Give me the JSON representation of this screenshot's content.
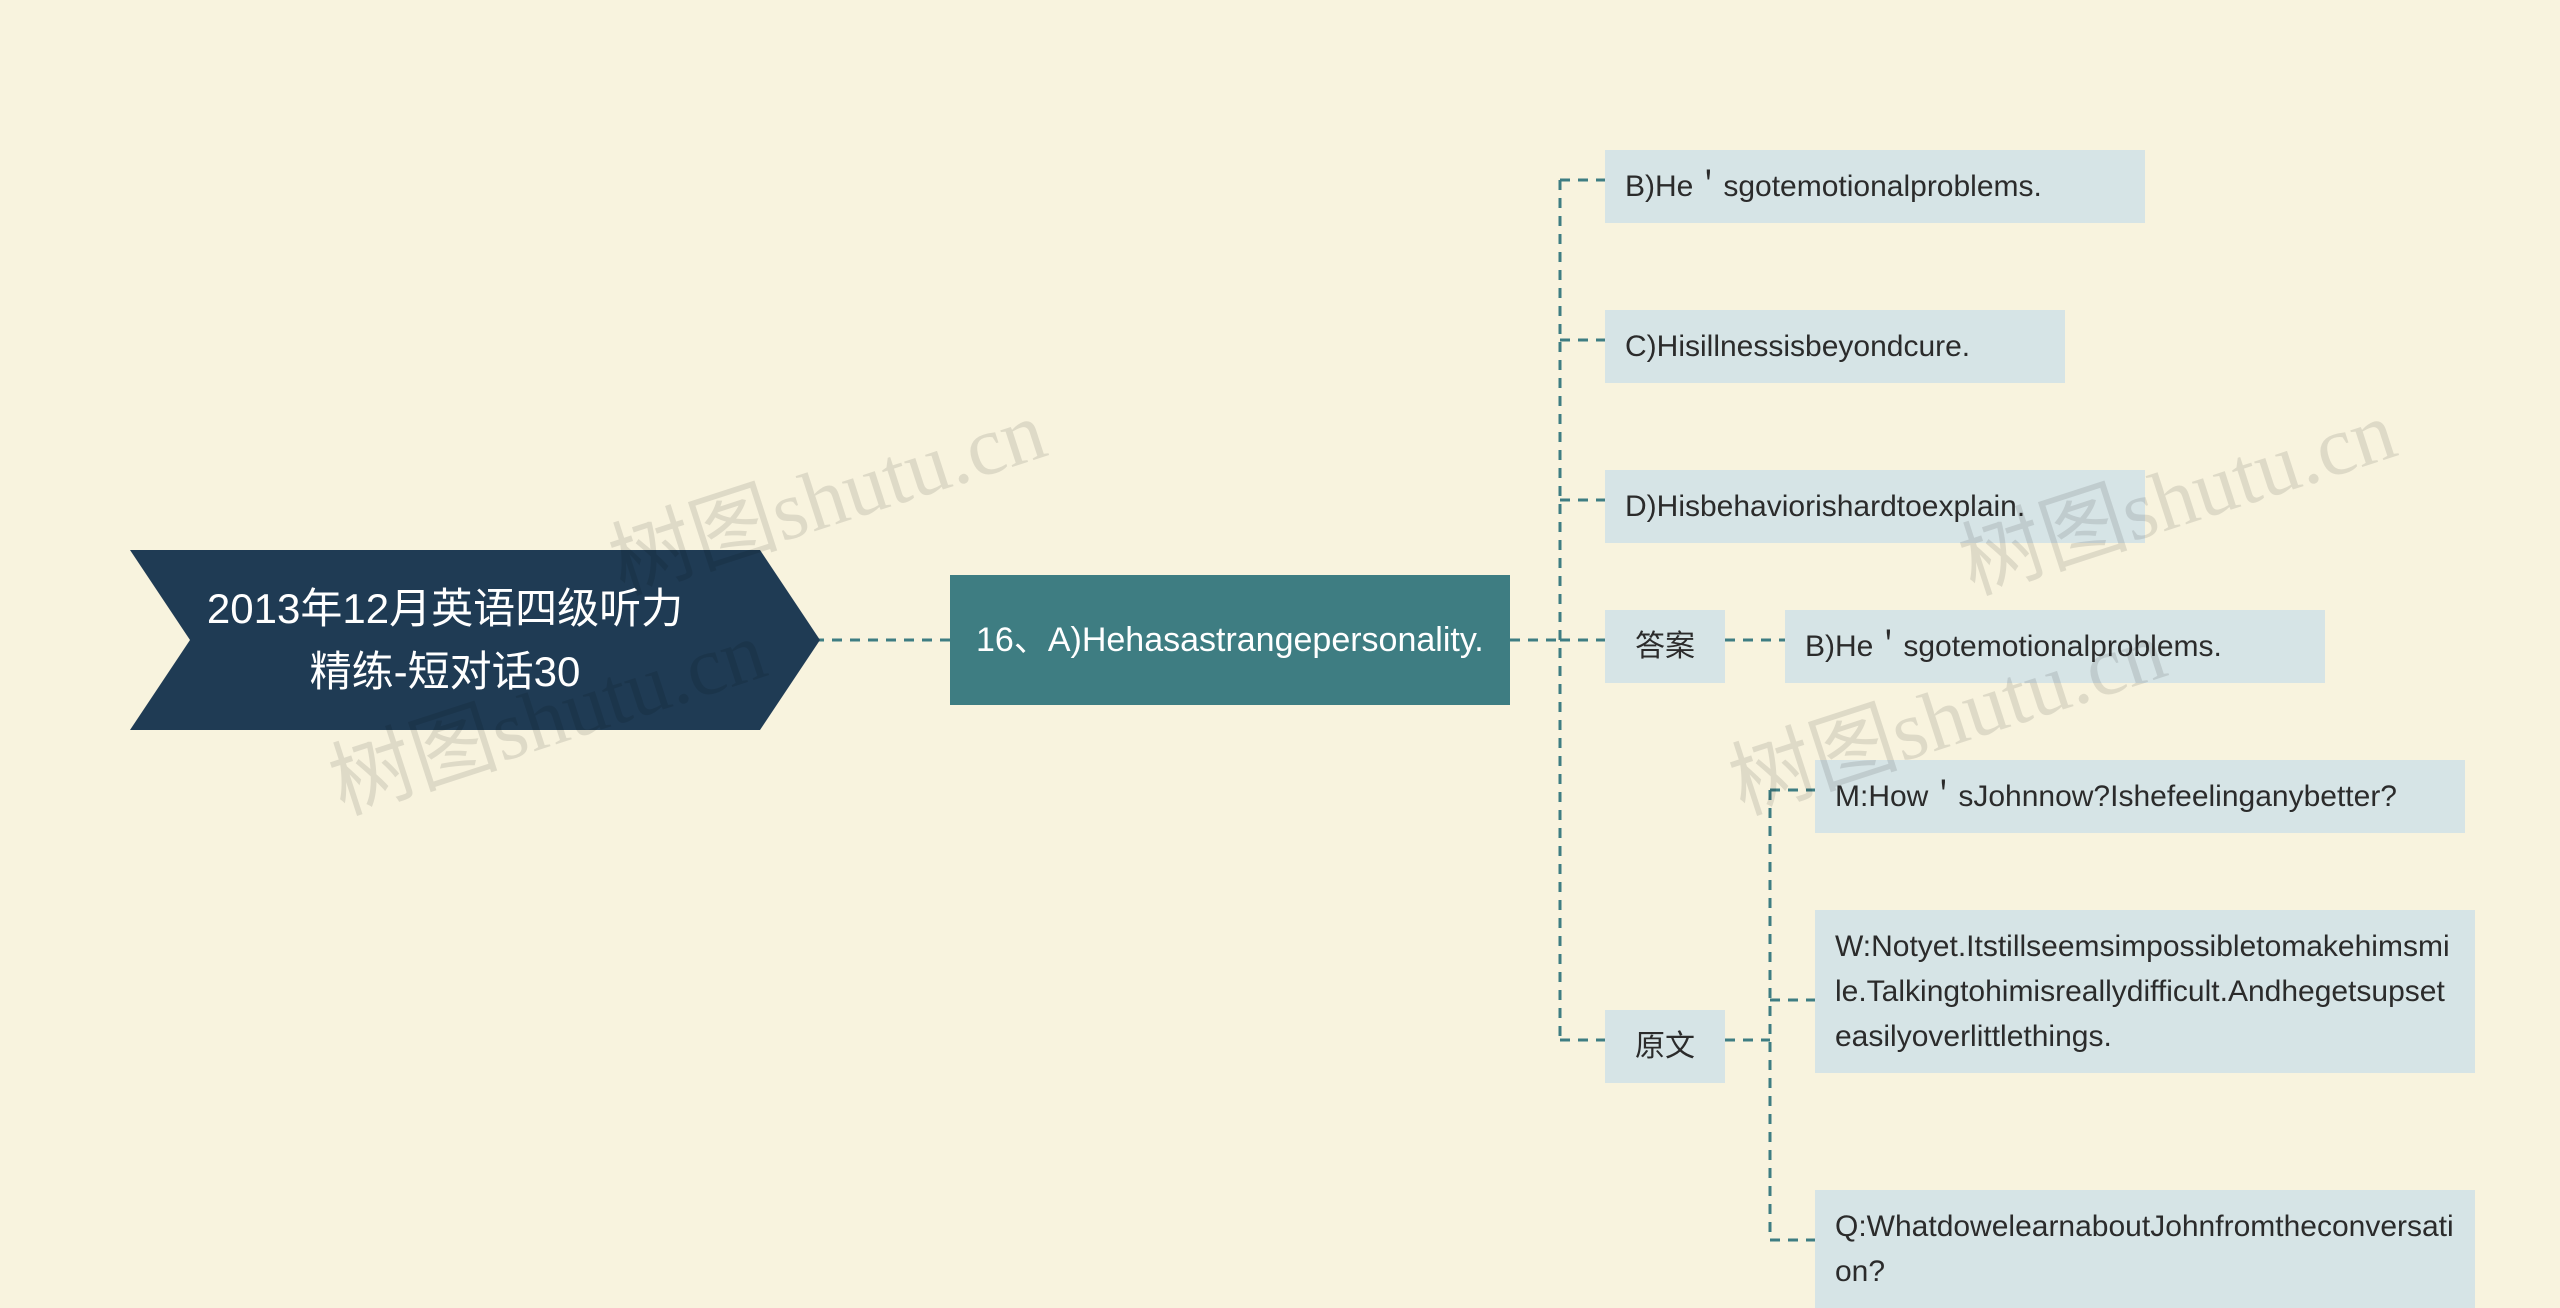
{
  "root": {
    "title_line1": "2013年12月英语四级听力",
    "title_line2": "精练-短对话30"
  },
  "level2": {
    "question_text": "16、A)Hehasastrangepersonality."
  },
  "options": {
    "b": "B)He＇sgotemotionalproblems.",
    "c": "C)Hisillnessisbeyondcure.",
    "d": "D)Hisbehaviorishardtoexplain."
  },
  "answer": {
    "label": "答案",
    "text": "B)He＇sgotemotionalproblems."
  },
  "source": {
    "label": "原文",
    "m": "M:How＇sJohnnow?Ishefeelinganybetter?",
    "w": "W:Notyet.Itstillseemsimpossibletomakehimsmile.Talkingtohimisreallydifficult.Andhegetsupseteasilyoverlittlethings.",
    "q": "Q:WhatdowelearnaboutJohnfromtheconversation?"
  },
  "watermark": "树图shutu.cn",
  "chart_data": {
    "type": "mindmap",
    "root": "2013年12月英语四级听力精练-短对话30",
    "children": [
      {
        "text": "16、A)Hehasastrangepersonality.",
        "children": [
          {
            "text": "B)He＇sgotemotionalproblems."
          },
          {
            "text": "C)Hisillnessisbeyondcure."
          },
          {
            "text": "D)Hisbehaviorishardtoexplain."
          },
          {
            "text": "答案",
            "children": [
              {
                "text": "B)He＇sgotemotionalproblems."
              }
            ]
          },
          {
            "text": "原文",
            "children": [
              {
                "text": "M:How＇sJohnnow?Ishefeelinganybetter?"
              },
              {
                "text": "W:Notyet.Itstillseemsimpossibletomakehimsmile.Talkingtohimisreallydifficult.Andhegetsupseteasilyoverlittlethings."
              },
              {
                "text": "Q:WhatdowelearnaboutJohnfromtheconversation?"
              }
            ]
          }
        ]
      }
    ]
  }
}
